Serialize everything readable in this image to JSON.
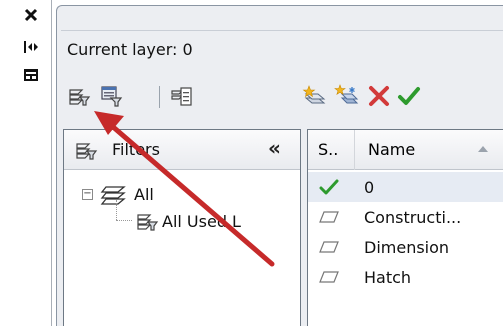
{
  "palette": {
    "current_layer_label": "Current layer: 0"
  },
  "strip": {
    "icons": [
      "close-icon",
      "auto-hide-icon",
      "properties-icon"
    ]
  },
  "toolbar": {
    "left_buttons": [
      "new-property-filter-icon",
      "new-group-filter-icon",
      "layer-states-manager-icon"
    ],
    "right_buttons": [
      "new-layer-icon",
      "new-layer-vp-frozen-icon",
      "delete-layer-icon",
      "set-current-icon"
    ]
  },
  "filters": {
    "header_label": "Filters",
    "collapse_glyph": "«",
    "tree": [
      {
        "label": "All",
        "expander": "⊟"
      },
      {
        "label": "All Used L"
      }
    ]
  },
  "layers": {
    "columns": {
      "status": "S..",
      "name": "Name"
    },
    "rows": [
      {
        "name": "0",
        "current": true
      },
      {
        "name": "Constructi..."
      },
      {
        "name": "Dimension"
      },
      {
        "name": "Hatch"
      }
    ]
  },
  "colors": {
    "arrow": "#c62a2a",
    "check": "#2e9b2e",
    "delete": "#d23a3a"
  }
}
